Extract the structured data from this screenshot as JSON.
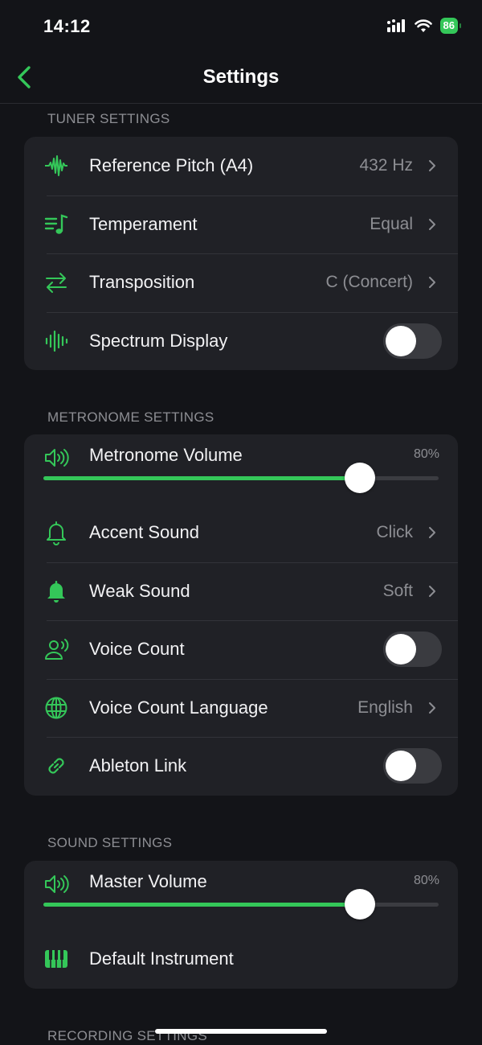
{
  "status": {
    "time": "14:12",
    "battery": "86"
  },
  "nav": {
    "title": "Settings"
  },
  "tuner": {
    "header": "TUNER SETTINGS",
    "reference_pitch": {
      "label": "Reference Pitch (A4)",
      "value": "432 Hz"
    },
    "temperament": {
      "label": "Temperament",
      "value": "Equal"
    },
    "transposition": {
      "label": "Transposition",
      "value": "C (Concert)"
    },
    "spectrum_display": {
      "label": "Spectrum Display",
      "on": false
    }
  },
  "metronome": {
    "header": "METRONOME SETTINGS",
    "volume": {
      "label": "Metronome Volume",
      "value": "80%",
      "level": 0.8
    },
    "accent_sound": {
      "label": "Accent Sound",
      "value": "Click"
    },
    "weak_sound": {
      "label": "Weak Sound",
      "value": "Soft"
    },
    "voice_count": {
      "label": "Voice Count",
      "on": false
    },
    "voice_language": {
      "label": "Voice Count Language",
      "value": "English"
    },
    "ableton_link": {
      "label": "Ableton Link",
      "on": false
    }
  },
  "sound": {
    "header": "SOUND SETTINGS",
    "master_volume": {
      "label": "Master Volume",
      "value": "80%",
      "level": 0.8
    },
    "default_instrument": {
      "label": "Default Instrument"
    }
  },
  "recording": {
    "header": "RECORDING SETTINGS"
  },
  "colors": {
    "accent": "#34c759",
    "background": "#131418",
    "card": "#202126",
    "secondary_text": "#8d8e93"
  }
}
